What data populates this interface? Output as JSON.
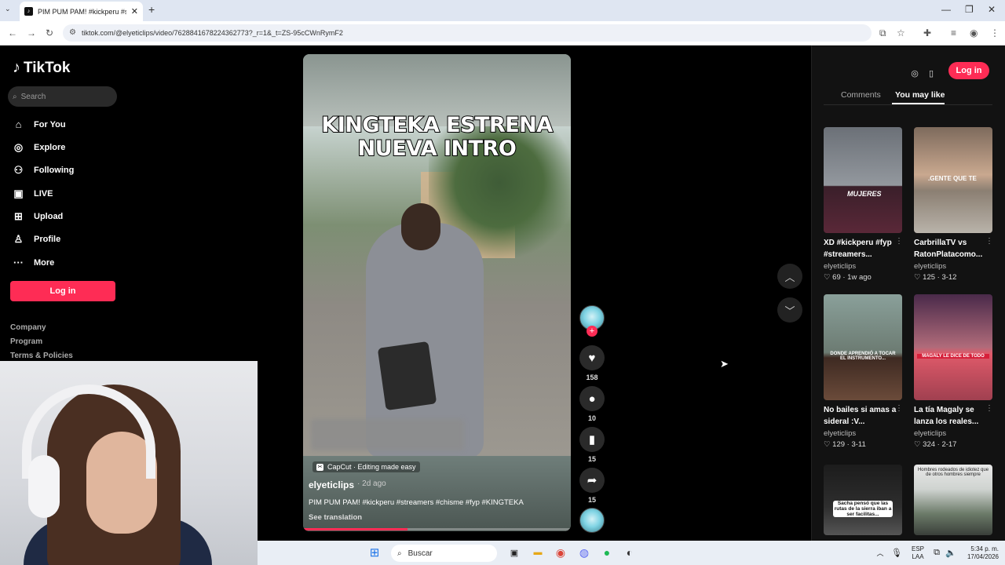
{
  "browser": {
    "tab_title": "PIM PUM PAM! #kickperu #str",
    "tab_close": "✕",
    "new_tab": "+",
    "url": "tiktok.com/@elyeticlips/video/7628841678224362773?_r=1&_t=ZS-95cCWnRymF2"
  },
  "sidebar": {
    "brand": "TikTok",
    "search_placeholder": "Search",
    "items": [
      {
        "label": "For You",
        "icon": "home-icon"
      },
      {
        "label": "Explore",
        "icon": "compass-icon"
      },
      {
        "label": "Following",
        "icon": "users-icon"
      },
      {
        "label": "LIVE",
        "icon": "live-icon"
      },
      {
        "label": "Upload",
        "icon": "upload-icon"
      },
      {
        "label": "Profile",
        "icon": "person-icon"
      },
      {
        "label": "More",
        "icon": "more-icon"
      }
    ],
    "login_label": "Log in",
    "footer": [
      "Company",
      "Program",
      "Terms & Policies"
    ]
  },
  "video": {
    "caption_line1": "KINGTEKA ESTRENA",
    "caption_line2": "NUEVA INTRO",
    "capcut_label": "CapCut · Editing made easy",
    "username": "elyeticlips",
    "posted": "· 2d ago",
    "description": "PIM PUM PAM! #kickperu #streamers #chisme #fyp #KINGTEKA",
    "see_translation": "See translation",
    "progress": 0.39
  },
  "actions": {
    "likes": "158",
    "comments": "10",
    "saves": "15",
    "shares": "15"
  },
  "right_panel": {
    "login_label": "Log in",
    "tabs": [
      "Comments",
      "You may like"
    ],
    "cards": [
      {
        "title": "XD #kickperu #fyp #streamers...",
        "user": "elyeticlips",
        "stats": "♡ 69 · 1w ago",
        "thumb_text": "MUJERES"
      },
      {
        "title": "CarbrillaTV vs RatonPlatacomo...",
        "user": "elyeticlips",
        "stats": "♡ 125 · 3-12",
        "thumb_text": ".GENTE QUE TE"
      },
      {
        "title": "No bailes si amas a sideral :V...",
        "user": "elyeticlips",
        "stats": "♡ 129 · 3-11",
        "thumb_text": "DONDE APRENDIÓ A TOCAR EL INSTRUMENTO..."
      },
      {
        "title": "La tía Magaly se lanza los reales...",
        "user": "elyeticlips",
        "stats": "♡ 324 · 2-17",
        "thumb_text": "MAGALY LE DICE DE TODO"
      },
      {
        "title": "",
        "user": "",
        "stats": "",
        "thumb_text": "Sacha pensó que las rutas de la sierra iban a ser facilitas..."
      },
      {
        "title": "",
        "user": "",
        "stats": "",
        "thumb_text": "Hombres rodeados de idiotez que de otros hombres siempre"
      }
    ]
  },
  "taskbar": {
    "search_placeholder": "Buscar",
    "lang_line1": "ESP",
    "lang_line2": "LAA",
    "time": "5:34 p. m.",
    "date": "17/04/2026"
  }
}
